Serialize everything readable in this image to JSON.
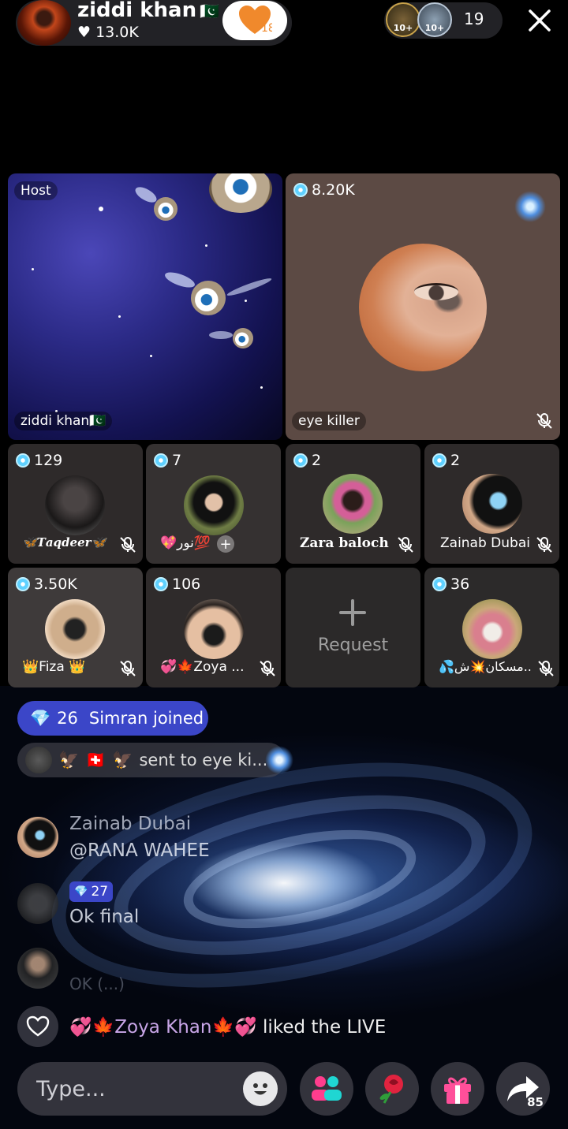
{
  "host": {
    "name": "ziddi khan",
    "flag": "🇵🇰",
    "likes": "13.0K",
    "follow_badge": "18"
  },
  "viewers": {
    "avatar1_badge": "10+",
    "avatar2_badge": "10+",
    "count": "19"
  },
  "grid": {
    "host_tile": {
      "tag": "Host",
      "name": "ziddi khan🇵🇰"
    },
    "guest_main": {
      "coins": "8.20K",
      "name": "eye killer"
    },
    "guests": [
      {
        "coins": "129",
        "name": "🦋𝑻𝒂𝒒𝒅𝒆𝒆𝒓🦋"
      },
      {
        "coins": "7",
        "name": "💖نور💯",
        "plus": "+"
      },
      {
        "coins": "2",
        "name": "Zara baloch"
      },
      {
        "coins": "2",
        "name": "Zainab Dubai"
      },
      {
        "coins": "3.50K",
        "name": "👑Fiza 👑"
      },
      {
        "coins": "106",
        "name": "💞🍁Zoya ..."
      },
      {
        "request": "Request"
      },
      {
        "coins": "36",
        "name": "💦مسکان💥ش.."
      }
    ]
  },
  "chat": {
    "joined": {
      "level": "26",
      "text": "Simran joined"
    },
    "sent": {
      "text": "sent to eye ki..."
    },
    "messages": [
      {
        "name": "Zainab Dubai",
        "text": "@RANA WAHEE"
      },
      {
        "level": "27",
        "text": "Ok final"
      },
      {
        "text": "OK (...)"
      }
    ],
    "liked": {
      "user": "💞🍁Zoya Khan🍁💞",
      "text": "liked the LIVE"
    }
  },
  "bottom_bar": {
    "input_placeholder": "Type...",
    "share_count": "85"
  },
  "colors": {
    "accent_blue": "#3b46c8",
    "coin_blue": "#5fd1ff",
    "follow_orange": "#f0892c"
  }
}
